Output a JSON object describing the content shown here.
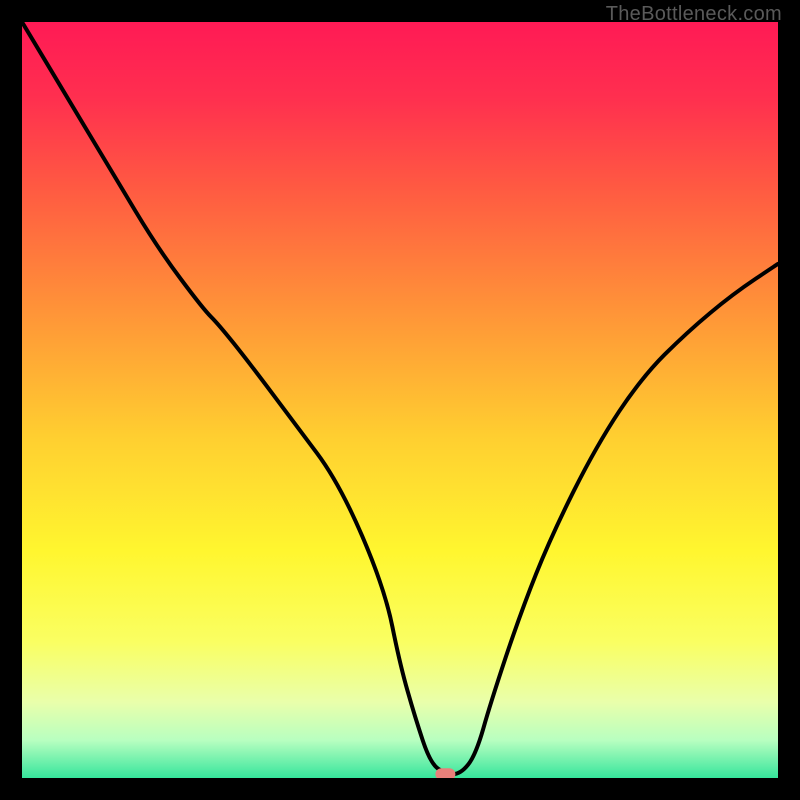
{
  "watermark": "TheBottleneck.com",
  "chart_data": {
    "type": "line",
    "title": "",
    "xlabel": "",
    "ylabel": "",
    "xlim": [
      0,
      100
    ],
    "ylim": [
      0,
      100
    ],
    "x": [
      0,
      6,
      12,
      18,
      24,
      26,
      30,
      36,
      42,
      48,
      50,
      52,
      54,
      56,
      58,
      60,
      62,
      66,
      70,
      76,
      82,
      88,
      94,
      100
    ],
    "values": [
      100,
      90,
      80,
      70,
      62,
      60,
      55,
      47,
      39,
      25,
      15,
      8,
      2,
      0.5,
      0.5,
      3,
      10,
      22,
      32,
      44,
      53,
      59,
      64,
      68
    ],
    "marker": {
      "x": 56,
      "y": 0.5,
      "color": "#e8807a"
    },
    "background_gradient": [
      {
        "stop": 0.0,
        "color": "#ff1a55"
      },
      {
        "stop": 0.1,
        "color": "#ff2f4f"
      },
      {
        "stop": 0.22,
        "color": "#ff5a42"
      },
      {
        "stop": 0.38,
        "color": "#ff9338"
      },
      {
        "stop": 0.55,
        "color": "#ffcf30"
      },
      {
        "stop": 0.7,
        "color": "#fff62f"
      },
      {
        "stop": 0.82,
        "color": "#faff62"
      },
      {
        "stop": 0.9,
        "color": "#e9ffab"
      },
      {
        "stop": 0.95,
        "color": "#b8ffc0"
      },
      {
        "stop": 1.0,
        "color": "#36e59c"
      }
    ]
  }
}
